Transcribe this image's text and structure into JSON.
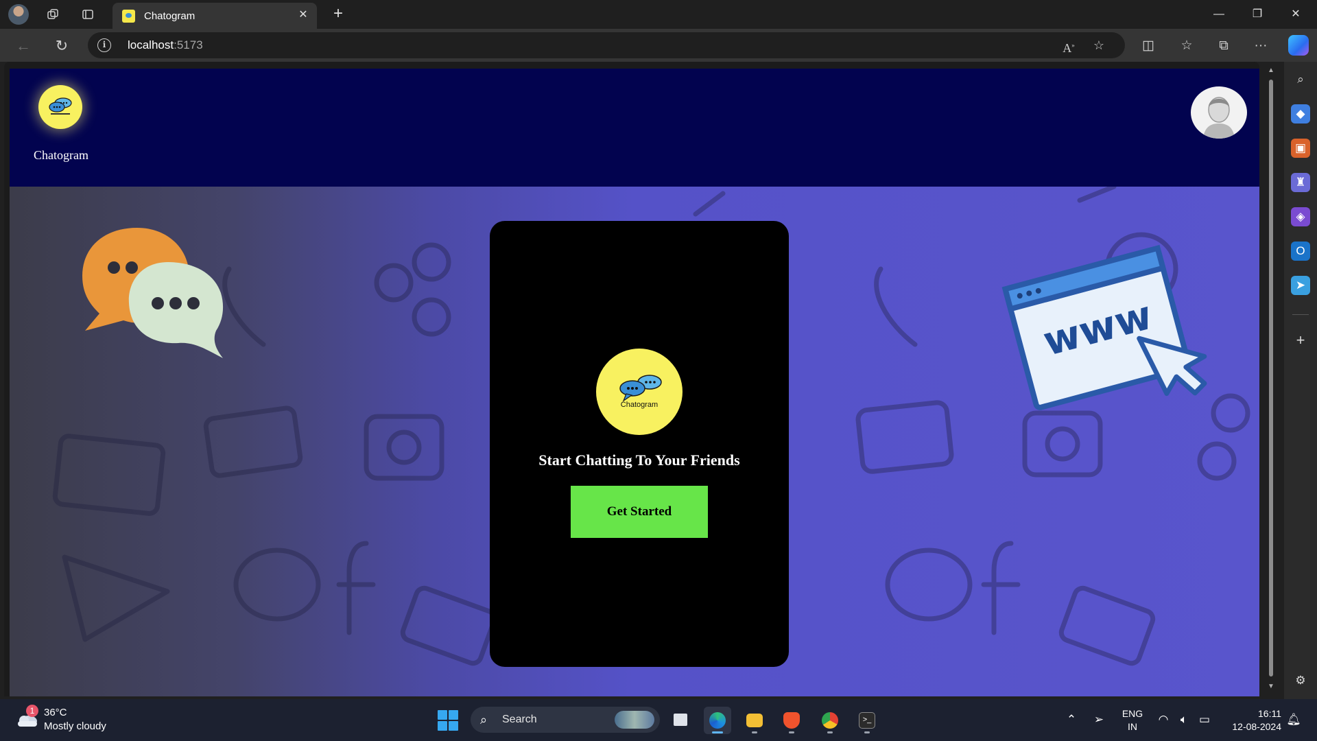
{
  "browser": {
    "tab_title": "Chatogram",
    "url_host": "localhost",
    "url_port": ":5173"
  },
  "app": {
    "brand_name": "Chatogram",
    "logo_text": "Chatogram",
    "hero_title": "Start Chatting To Your Friends",
    "cta_label": "Get Started",
    "colors": {
      "header_bg": "#02034f",
      "logo_bg": "#f8f160",
      "cta_bg": "#67e549",
      "card_bg": "#000000",
      "hero_accent": "#5955cc"
    }
  },
  "taskbar": {
    "weather_temp": "36°C",
    "weather_desc": "Mostly cloudy",
    "weather_badge": "1",
    "search_placeholder": "Search",
    "lang_line1": "ENG",
    "lang_line2": "IN",
    "time": "16:11",
    "date": "12-08-2024"
  }
}
